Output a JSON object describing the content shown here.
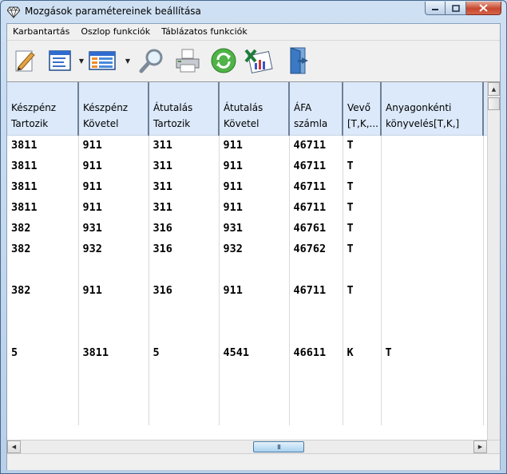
{
  "window": {
    "title": "Mozgások paramétereinek beállítása"
  },
  "menu": [
    "Karbantartás",
    "Oszlop funkciók",
    "Táblázatos funkciók"
  ],
  "toolbar": {
    "icons": [
      "edit-pencil-icon",
      "form-view-icon",
      "table-view-icon",
      "search-magnifier-icon",
      "print-icon",
      "refresh-icon",
      "excel-export-icon",
      "exit-door-icon"
    ]
  },
  "grid": {
    "columns": [
      {
        "line1": "Készpénz",
        "line2": "Tartozik"
      },
      {
        "line1": "Készpénz",
        "line2": "Követel"
      },
      {
        "line1": "Átutalás",
        "line2": "Tartozik"
      },
      {
        "line1": "Átutalás",
        "line2": "Követel"
      },
      {
        "line1": "ÁFA",
        "line2": "számla"
      },
      {
        "line1": "Vevő",
        "line2": "[T,K,..."
      },
      {
        "line1": "Anyagonkénti",
        "line2": "könyvelés[T,K,]"
      }
    ],
    "rows": [
      [
        "3811",
        "911",
        "311",
        "911",
        "46711",
        "T",
        ""
      ],
      [
        "3811",
        "911",
        "311",
        "911",
        "46711",
        "T",
        ""
      ],
      [
        "3811",
        "911",
        "311",
        "911",
        "46711",
        "T",
        ""
      ],
      [
        "3811",
        "911",
        "311",
        "911",
        "46711",
        "T",
        ""
      ],
      [
        "382",
        "931",
        "316",
        "931",
        "46761",
        "T",
        ""
      ],
      [
        "382",
        "932",
        "316",
        "932",
        "46762",
        "T",
        ""
      ],
      [
        "",
        "",
        "",
        "",
        "",
        "",
        ""
      ],
      [
        "382",
        "911",
        "316",
        "911",
        "46711",
        "T",
        ""
      ],
      [
        "",
        "",
        "",
        "",
        "",
        "",
        ""
      ],
      [
        "",
        "",
        "",
        "",
        "",
        "",
        ""
      ],
      [
        "5",
        "3811",
        "5",
        "4541",
        "46611",
        "K",
        "T"
      ],
      [
        "",
        "",
        "",
        "",
        "",
        "",
        ""
      ],
      [
        "",
        "",
        "",
        "",
        "",
        "",
        ""
      ],
      [
        "",
        "",
        "",
        "",
        "",
        "",
        ""
      ]
    ]
  },
  "scrollbar": {
    "thumb_grip": "III"
  }
}
